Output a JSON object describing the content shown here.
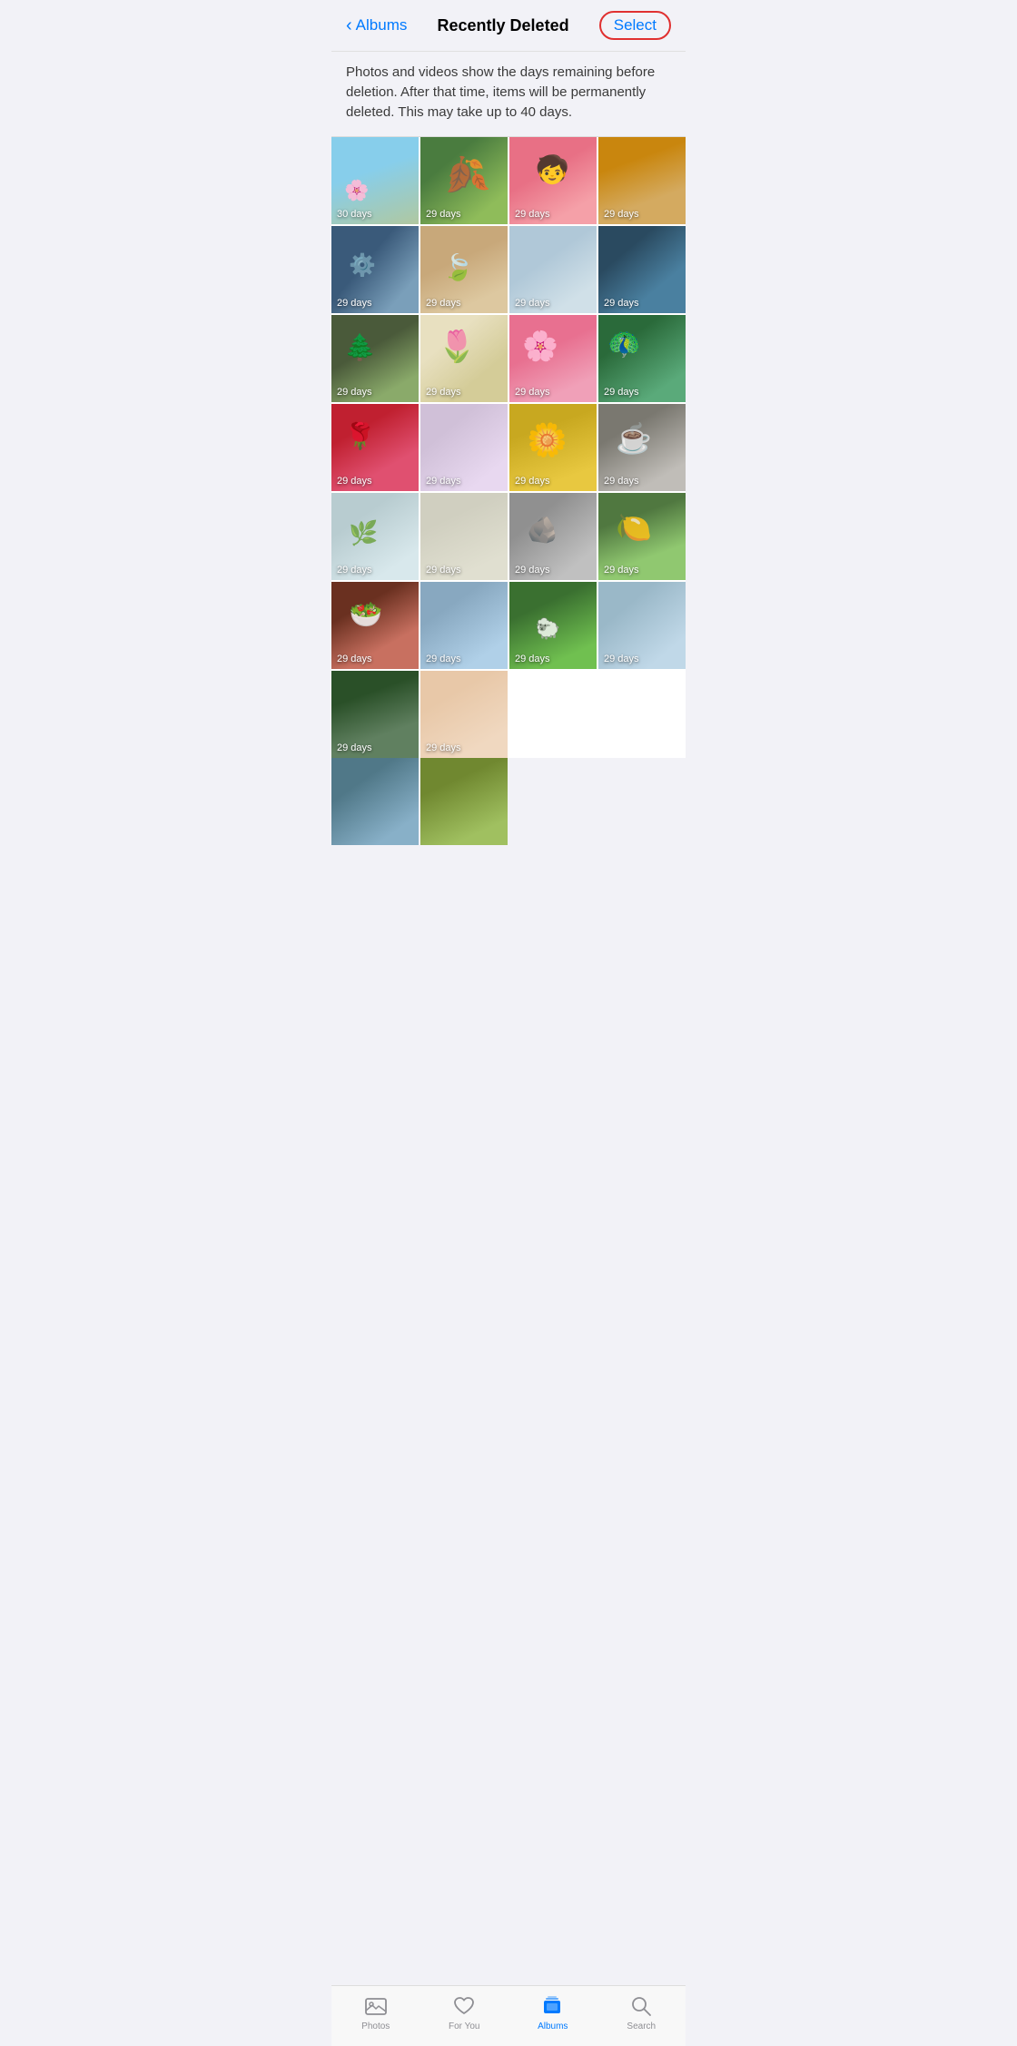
{
  "nav": {
    "back_label": "Albums",
    "title": "Recently Deleted",
    "select_label": "Select"
  },
  "info_banner": {
    "text": "Photos and videos show the days remaining before deletion. After that time, items will be permanently deleted. This may take up to 40 days."
  },
  "photos": [
    {
      "id": 1,
      "days": "30 days",
      "class": "photo-1"
    },
    {
      "id": 2,
      "days": "29 days",
      "class": "photo-2"
    },
    {
      "id": 3,
      "days": "29 days",
      "class": "photo-3"
    },
    {
      "id": 4,
      "days": "29 days",
      "class": "photo-4"
    },
    {
      "id": 5,
      "days": "29 days",
      "class": "photo-5"
    },
    {
      "id": 6,
      "days": "29 days",
      "class": "photo-6"
    },
    {
      "id": 7,
      "days": "29 days",
      "class": "photo-7"
    },
    {
      "id": 8,
      "days": "29 days",
      "class": "photo-8"
    },
    {
      "id": 9,
      "days": "29 days",
      "class": "photo-9"
    },
    {
      "id": 10,
      "days": "29 days",
      "class": "photo-10"
    },
    {
      "id": 11,
      "days": "29 days",
      "class": "photo-11"
    },
    {
      "id": 12,
      "days": "29 days",
      "class": "photo-12"
    },
    {
      "id": 13,
      "days": "29 days",
      "class": "photo-13"
    },
    {
      "id": 14,
      "days": "29 days",
      "class": "photo-14"
    },
    {
      "id": 15,
      "days": "29 days",
      "class": "photo-15"
    },
    {
      "id": 16,
      "days": "29 days",
      "class": "photo-16"
    },
    {
      "id": 17,
      "days": "29 days",
      "class": "photo-17"
    },
    {
      "id": 18,
      "days": "29 days",
      "class": "photo-18"
    },
    {
      "id": 19,
      "days": "29 days",
      "class": "photo-19"
    },
    {
      "id": 20,
      "days": "29 days",
      "class": "photo-20"
    },
    {
      "id": 21,
      "days": "29 days",
      "class": "photo-21"
    },
    {
      "id": 22,
      "days": "29 days",
      "class": "photo-22"
    },
    {
      "id": 23,
      "days": "29 days",
      "class": "photo-23"
    },
    {
      "id": 24,
      "days": "29 days",
      "class": "photo-24"
    },
    {
      "id": 25,
      "days": "29 days",
      "class": "photo-25"
    },
    {
      "id": 26,
      "days": "29 days",
      "class": "photo-26"
    }
  ],
  "partial_photos": [
    {
      "id": 27,
      "class": "photo-27"
    },
    {
      "id": 28,
      "class": "photo-28"
    }
  ],
  "tabs": [
    {
      "id": "photos",
      "label": "Photos",
      "active": false
    },
    {
      "id": "for-you",
      "label": "For You",
      "active": false
    },
    {
      "id": "albums",
      "label": "Albums",
      "active": true
    },
    {
      "id": "search",
      "label": "Search",
      "active": false
    }
  ]
}
